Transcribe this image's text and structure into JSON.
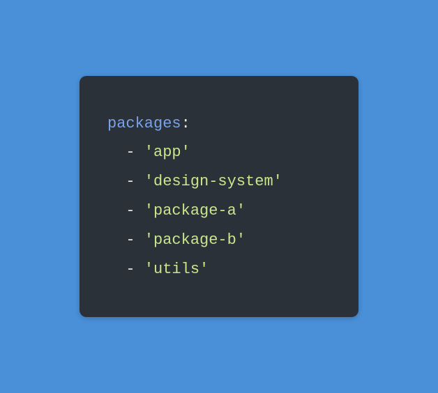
{
  "yaml": {
    "key": "packages",
    "colon": ":",
    "indent": "  ",
    "dash": "- ",
    "items": [
      "'app'",
      "'design-system'",
      "'package-a'",
      "'package-b'",
      "'utils'"
    ]
  }
}
